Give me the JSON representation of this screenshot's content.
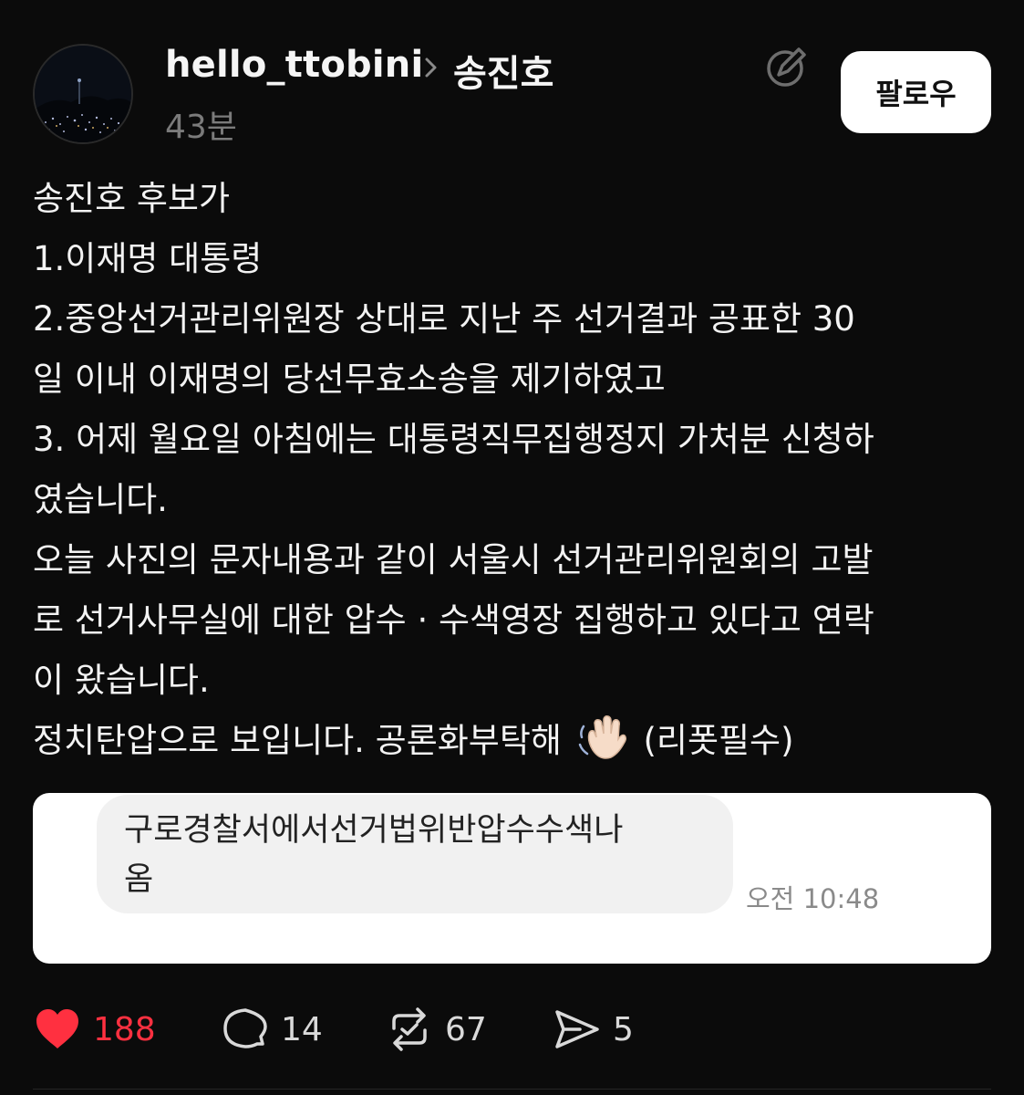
{
  "post": {
    "username": "hello_ttobini",
    "recipient": "송진호",
    "time": "43분",
    "follow_label": "팔로우",
    "icons": {
      "chevron": "chevron-right-icon",
      "edit": "edit-circle-icon",
      "wave": "waving-hand-emoji"
    },
    "body": {
      "p1": "송진호 후보가",
      "p2": "1.이재명 대통령",
      "p3": "2.중앙선거관리위원장 상대로 지난 주 선거결과 공표한 30\n일 이내 이재명의 당선무효소송을 제기하였고",
      "p4": "3. 어제 월요일 아침에는 대통령직무집행정지 가처분 신청하\n였습니다.",
      "p5": "오늘 사진의 문자내용과 같이 서울시 선거관리위원회의 고발\n로 선거사무실에 대한 압수 · 수색영장 집행하고 있다고 연락\n이 왔습니다.",
      "p6_before": "정치탄압으로 보입니다. 공론화부탁해",
      "p6_after": "(리폿필수)"
    },
    "image": {
      "message": "구로경찰서에서선거법위반압수수색나\n옴",
      "message_time": "오전 10:48"
    },
    "actions": {
      "like_count": "188",
      "comment_count": "14",
      "repost_count": "67",
      "share_count": "5"
    }
  },
  "colors": {
    "background": "#0b0b0b",
    "like": "#ff3040",
    "muted": "#7b7b7b"
  }
}
